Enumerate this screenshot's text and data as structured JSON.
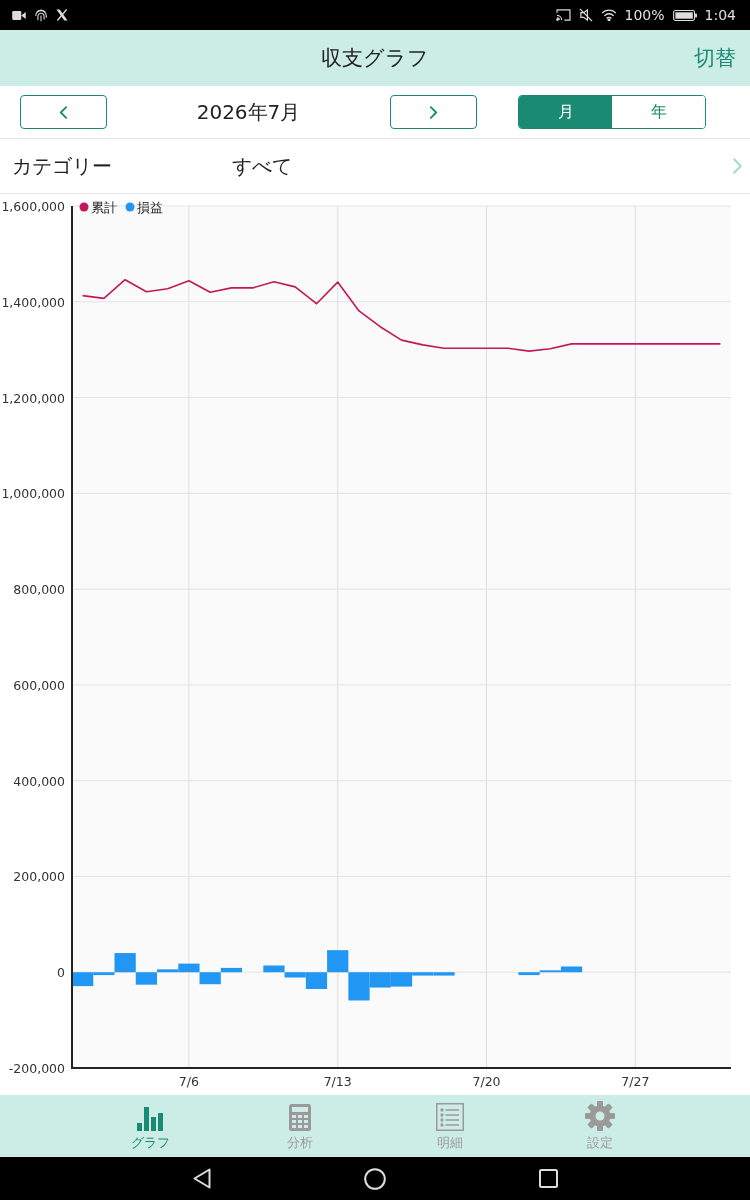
{
  "status_bar": {
    "battery": "100%",
    "time": "1:04"
  },
  "header": {
    "title": "収支グラフ",
    "action": "切替"
  },
  "period": {
    "label": "2026年7月",
    "modes": [
      {
        "label": "月",
        "selected": true
      },
      {
        "label": "年",
        "selected": false
      }
    ]
  },
  "filter": {
    "label": "カテゴリー",
    "value": "すべて"
  },
  "chart": {
    "chart_data": {
      "type": "line",
      "categories": [
        null,
        null,
        null,
        null,
        null,
        "7/6",
        null,
        null,
        null,
        null,
        null,
        null,
        "7/13",
        null,
        null,
        null,
        null,
        null,
        null,
        "7/20",
        null,
        null,
        null,
        null,
        null,
        null,
        "7/27",
        null,
        null,
        null,
        null
      ],
      "ylim": [
        -200000,
        1600000
      ],
      "yticks": [
        {
          "value": -200000,
          "label": "-200,000"
        },
        {
          "value": 0,
          "label": "0"
        },
        {
          "value": 200000,
          "label": "200,000"
        },
        {
          "value": 400000,
          "label": "400,000"
        },
        {
          "value": 600000,
          "label": "600,000"
        },
        {
          "value": 800000,
          "label": "800,000"
        },
        {
          "value": 1000000,
          "label": "1,000,000"
        },
        {
          "value": 1200000,
          "label": "1,200,000"
        },
        {
          "value": 1400000,
          "label": "1,400,000"
        },
        {
          "value": 1600000,
          "label": "1,600,000"
        }
      ],
      "grid": true,
      "legend": "top",
      "series": [
        {
          "name": "累計",
          "color": "#c2185b",
          "values": [
            1413000,
            1407000,
            1446000,
            1421000,
            1427000,
            1444000,
            1420000,
            1429000,
            1429000,
            1442000,
            1431000,
            1396000,
            1441000,
            1381000,
            1348000,
            1320000,
            1310000,
            1303000,
            1303000,
            1303000,
            1303000,
            1297000,
            1302000,
            1312000,
            1312000,
            1312000,
            1312000,
            1312000,
            1312000,
            1312000,
            1312000
          ]
        },
        {
          "name": "損益",
          "type": "bar",
          "color": "#2196f3",
          "values": [
            -29000,
            -6000,
            40000,
            -26000,
            6000,
            18000,
            -25000,
            9000,
            0,
            14000,
            -11000,
            -35000,
            46000,
            -59000,
            -32000,
            -30000,
            -7000,
            -7000,
            0,
            0,
            0,
            -6000,
            4000,
            12000,
            0,
            0,
            0,
            0,
            0,
            0,
            0
          ]
        }
      ]
    }
  },
  "bottom_nav": [
    {
      "label": "グラフ",
      "selected": true
    },
    {
      "label": "分析",
      "selected": false
    },
    {
      "label": "明細",
      "selected": false
    },
    {
      "label": "設定",
      "selected": false
    }
  ]
}
